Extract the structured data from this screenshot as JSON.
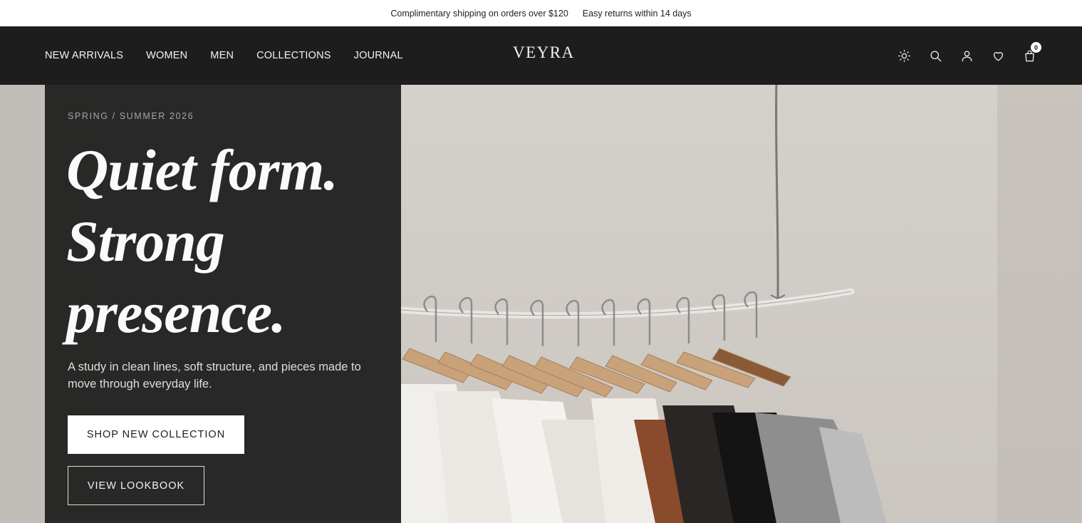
{
  "announcement": {
    "shipping": "Complimentary shipping on orders over $120",
    "returns": "Easy returns within 14 days"
  },
  "nav": {
    "links": [
      "NEW ARRIVALS",
      "WOMEN",
      "MEN",
      "COLLECTIONS",
      "JOURNAL"
    ],
    "logo": "VEYRA",
    "icons": [
      "sun-icon",
      "search-icon",
      "user-icon",
      "heart-icon",
      "cart-icon"
    ],
    "cart_count": "0"
  },
  "hero": {
    "eyebrow": "SPRING / SUMMER 2026",
    "headline": [
      "Quiet form.",
      "Strong",
      "presence."
    ],
    "subtext": "A study in clean lines, soft structure, and pieces made to move through everyday life.",
    "primary_cta": "SHOP NEW COLLECTION",
    "secondary_cta": "VIEW LOOKBOOK"
  },
  "colors": {
    "nav_bg": "#1d1d1d",
    "panel_bg": "#202020",
    "hero_bg": "#d6d2cd"
  }
}
